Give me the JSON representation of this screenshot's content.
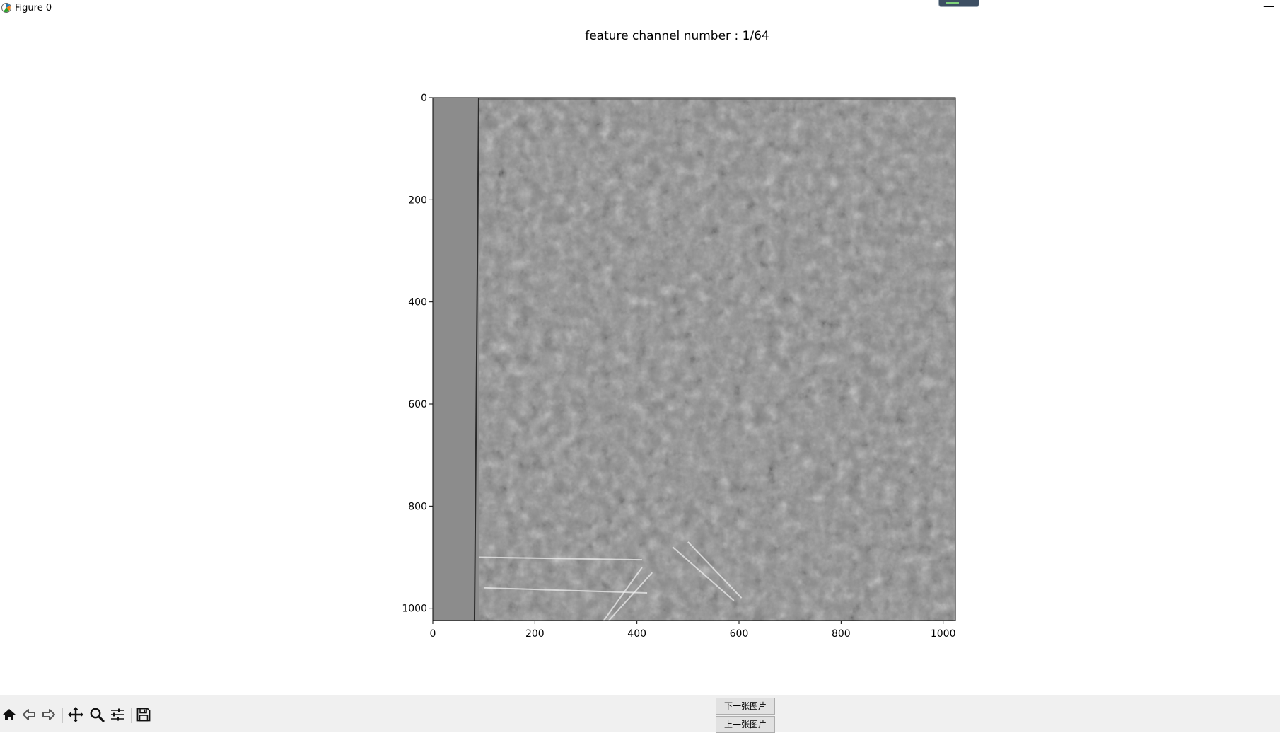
{
  "window": {
    "title": "Figure 0",
    "minimize_glyph": "—"
  },
  "figure": {
    "title": "feature channel number : 1/64"
  },
  "chart_data": {
    "type": "heatmap",
    "title": "feature channel number : 1/64",
    "xlabel": "",
    "ylabel": "",
    "xlim": [
      0,
      1024
    ],
    "ylim": [
      1024,
      0
    ],
    "xticks": [
      0,
      200,
      400,
      600,
      800,
      1000
    ],
    "yticks": [
      0,
      200,
      400,
      600,
      800,
      1000
    ],
    "colormap": "gray",
    "grid": false
  },
  "buttons": {
    "next": "下一张图片",
    "prev": "上一张图片"
  },
  "toolbar": {
    "items": [
      "home-icon",
      "back-arrow-icon",
      "forward-arrow-icon",
      "pan-icon",
      "zoom-icon",
      "subplots-config-icon",
      "save-icon"
    ]
  },
  "colors": {
    "toolbar_bg": "#f0f0f0",
    "image_gray": "#8a8a8a",
    "strip_gray": "#8c8c8c"
  }
}
